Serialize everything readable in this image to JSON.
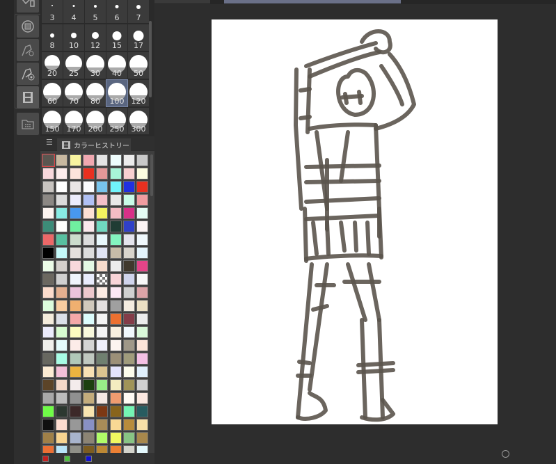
{
  "brush_sizes": {
    "items": [
      "3",
      "4",
      "5",
      "6",
      "7",
      "8",
      "10",
      "12",
      "15",
      "17",
      "20",
      "25",
      "30",
      "40",
      "50",
      "60",
      "70",
      "80",
      "100",
      "120",
      "150",
      "170",
      "200",
      "250",
      "300"
    ],
    "selected": "100"
  },
  "color_history": {
    "menu_icon": "hamburger-icon",
    "tab_icon": "film-icon",
    "tab_label": "カラーヒストリー",
    "selected_index": 0,
    "colors": [
      "#5a5650",
      "#c8b8a0",
      "#f8f4a0",
      "#f0a8b0",
      "#e4e4e4",
      "#eefcfc",
      "#ececec",
      "#c8c8c8",
      "#f8d8dc",
      "#fcecec",
      "#fce4dc",
      "#e83020",
      "#e49898",
      "#a8f4d8",
      "#f8d0d0",
      "#fcfce0",
      "#c8c4c0",
      "#ffffff",
      "#e8e4e4",
      "#fafafc",
      "#78c4ec",
      "#70f4fc",
      "#2030e0",
      "#e83020",
      "#8c8884",
      "#dcdcdc",
      "#ececfc",
      "#b0c0f4",
      "#f4c0c8",
      "#e8e8e8",
      "#c8fce8",
      "#f09ca0",
      "#fcf4f0",
      "#88ece4",
      "#4898f0",
      "#fce0d4",
      "#f4f460",
      "#f4bcc4",
      "#d83088",
      "#e4fcf4",
      "#3c8c78",
      "#fffffc",
      "#70f0a0",
      "#fce8ec",
      "#70d8c0",
      "#203c34",
      "#3040c8",
      "#fcf4f4",
      "#ec6868",
      "#58c0a0",
      "#ccdccc",
      "#dcdcdc",
      "#e8f8fc",
      "#84f4c0",
      "#e4e4ec",
      "#f0f8fc",
      "#000000",
      "#c4f8f8",
      "#e4e0dc",
      "#dcdcdc",
      "#e0e4f4",
      "#c8bca8",
      "#d8d4cc",
      "#e4f4fc",
      "#ecfce8",
      "#d4d0cc",
      "#f8d8dc",
      "#e4f8e4",
      "#f8dccc",
      "#ececec",
      "#40382c",
      "#e44488",
      "#6c6860",
      "#d0d0d0",
      "#f0f4fc",
      "#e8ecfc",
      "transparent",
      "#f8d4d8",
      "#d0d4ec",
      "#f8f8f8",
      "#fcdccc",
      "#e4b090",
      "#ecc4dc",
      "#ecc8cc",
      "#fcece4",
      "#fce8f4",
      "#d0d0d0",
      "#dca4a8",
      "#dcfcdc",
      "#f8cca0",
      "#f0b070",
      "#d0c8bc",
      "#e4e0e0",
      "#a0a0a0",
      "#f4ece0",
      "#ece0c4",
      "#f4ecdc",
      "#dce0e8",
      "#f4a8a8",
      "#dcfcfc",
      "#f4f4f4",
      "#ec7030",
      "#843c48",
      "#ececec",
      "#ececfc",
      "#d8fcd0",
      "#fcfcc0",
      "#f8f8dc",
      "#f4f4f4",
      "#f8f0e0",
      "#f0f8fc",
      "#d8f8d8",
      "#f0f0ec",
      "#e4fcfc",
      "#fcece8",
      "#d4d4d4",
      "#eff0fc",
      "#fcf4f0",
      "#a09888",
      "#fce4d8",
      "#686860",
      "#a8fce4",
      "#b0c8b8",
      "#c0c8c0",
      "#708070",
      "#9c9078",
      "#a09c7c",
      "#f4c0e4",
      "#fcecd4",
      "#f4c0d8",
      "#ecb440",
      "#f8e0b4",
      "#dcc490",
      "#e4e4fc",
      "#fcfcec",
      "#e0f0fc",
      "#5c4428",
      "#f4d8c8",
      "#f4ecec",
      "#1c4010",
      "#98ec88",
      "#f4ecc0",
      "#a09458",
      "#d0d0d0",
      "#a8a8a8",
      "#bcbcbc",
      "#909090",
      "#c4ac7c",
      "#f4e8e4",
      "#f09c70",
      "#fffaf4",
      "#fce8e0",
      "#70fc48",
      "#2c3830",
      "#3c2828",
      "#f8e4b0",
      "#7c3814",
      "#88641c",
      "#74f4b4",
      "#285c60",
      "#101010",
      "#fcdcd0",
      "#989898",
      "#8890c4",
      "#a88c58",
      "#f8d894",
      "#b88c3c",
      "#f8e0a8",
      "#a08048",
      "#f8d490",
      "#a8b4cc",
      "#8c8474",
      "#b0fc68",
      "#f0f860",
      "#88c484",
      "#a8884c",
      "#ec7034",
      "#b8e4f8",
      "#909088",
      "#7c5c20",
      "#bc8834",
      "#ec8034",
      "#d4d4cc",
      "#e4f8fc"
    ],
    "footer_swatches": [
      "#c02020",
      "#50c040",
      "#1010d0"
    ]
  },
  "toolbar_icons": [
    "layer-property-icon",
    "stop-record-icon",
    "brush-settings-icon",
    "brush-target-icon",
    "timeline-icon",
    "material-folder-icon"
  ],
  "sketch": {
    "stroke_color": "#5b544c"
  }
}
